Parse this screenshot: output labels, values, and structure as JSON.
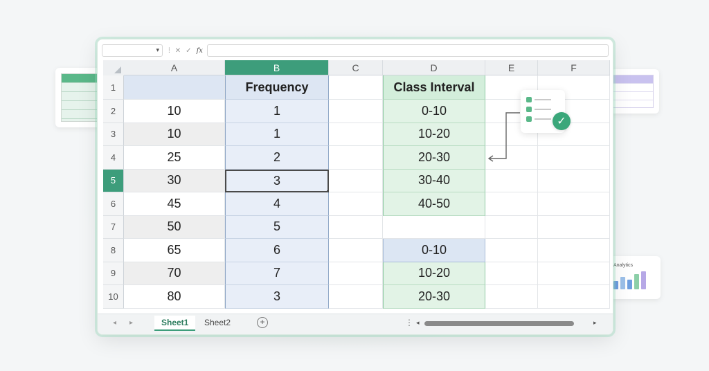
{
  "formula_bar": {
    "name_box": "",
    "formula": "",
    "fx_label": "fx"
  },
  "columns": [
    "A",
    "B",
    "C",
    "D",
    "E",
    "F"
  ],
  "active_column": "B",
  "active_row": "5",
  "rows": [
    {
      "num": "1",
      "A": "",
      "B": "Frequency",
      "C": "",
      "D": "Class Interval"
    },
    {
      "num": "2",
      "A": "10",
      "B": "1",
      "C": "",
      "D": "0-10"
    },
    {
      "num": "3",
      "A": "10",
      "B": "1",
      "C": "",
      "D": "10-20"
    },
    {
      "num": "4",
      "A": "25",
      "B": "2",
      "C": "",
      "D": "20-30"
    },
    {
      "num": "5",
      "A": "30",
      "B": "3",
      "C": "",
      "D": "30-40"
    },
    {
      "num": "6",
      "A": "45",
      "B": "4",
      "C": "",
      "D": "40-50"
    },
    {
      "num": "7",
      "A": "50",
      "B": "5",
      "C": "",
      "D": ""
    },
    {
      "num": "8",
      "A": "65",
      "B": "6",
      "C": "",
      "D": "0-10"
    },
    {
      "num": "9",
      "A": "70",
      "B": "7",
      "C": "",
      "D": "10-20"
    },
    {
      "num": "10",
      "A": "80",
      "B": "3",
      "C": "",
      "D": "20-30"
    }
  ],
  "sheets": [
    "Sheet1",
    "Sheet2"
  ],
  "active_sheet": "Sheet1",
  "deco": {
    "analytics_label": "Analytics"
  },
  "colors": {
    "accent": "#3d9d7b",
    "frequency_fill": "#e8eef8",
    "interval_fill": "#e2f3e6"
  },
  "icons": {
    "name_box_caret": "caret-down-icon",
    "cancel": "x-icon",
    "confirm": "checkmark-icon",
    "add_sheet": "plus-circle-icon",
    "check_badge": "check-circle-icon"
  }
}
